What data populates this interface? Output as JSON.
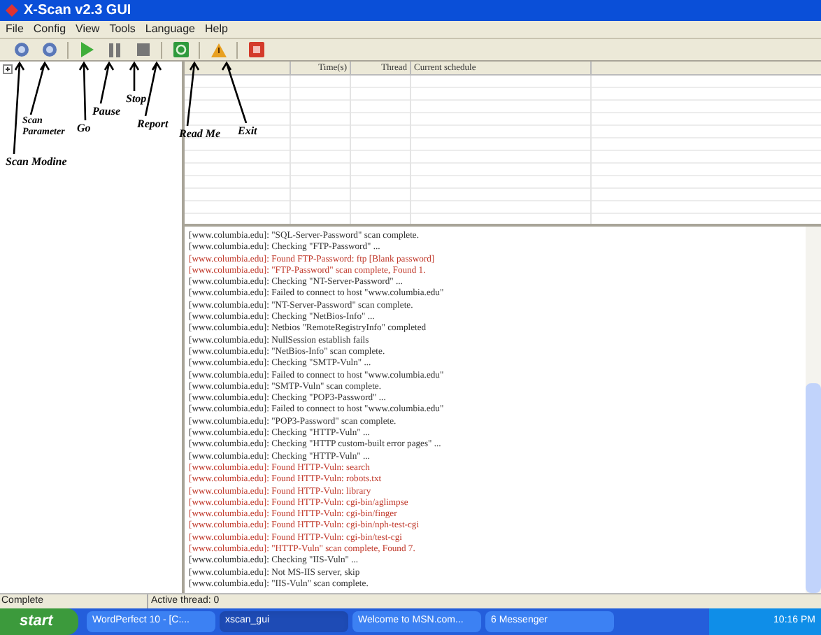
{
  "window": {
    "title": "X-Scan v2.3 GUI"
  },
  "menu": [
    "File",
    "Config",
    "View",
    "Tools",
    "Language",
    "Help"
  ],
  "toolbar": [
    {
      "kind": "module"
    },
    {
      "kind": "parameter"
    },
    {
      "kind": "go"
    },
    {
      "kind": "pause"
    },
    {
      "kind": "stop"
    },
    {
      "kind": "report"
    },
    {
      "kind": "readme"
    },
    {
      "kind": "exit"
    }
  ],
  "annotations": [
    "Scan Modine",
    "Scan Parameter",
    "Go",
    "Pause",
    "Stop",
    "Report",
    "Read Me",
    "Exit"
  ],
  "table": {
    "columns": [
      "Time(s)",
      "Thread",
      "Current schedule"
    ]
  },
  "log": [
    {
      "kind": "info",
      "text": "[www.columbia.edu]: \"SQL-Server-Password\" scan complete."
    },
    {
      "kind": "info",
      "text": "[www.columbia.edu]: Checking \"FTP-Password\" ..."
    },
    {
      "kind": "found",
      "text": "[www.columbia.edu]: Found FTP-Password: ftp [Blank password]"
    },
    {
      "kind": "found",
      "text": "[www.columbia.edu]: \"FTP-Password\" scan complete, Found 1."
    },
    {
      "kind": "info",
      "text": "[www.columbia.edu]: Checking \"NT-Server-Password\" ..."
    },
    {
      "kind": "info",
      "text": "[www.columbia.edu]: Failed to connect to host \"www.columbia.edu\""
    },
    {
      "kind": "info",
      "text": "[www.columbia.edu]: \"NT-Server-Password\" scan complete."
    },
    {
      "kind": "info",
      "text": "[www.columbia.edu]: Checking \"NetBios-Info\" ..."
    },
    {
      "kind": "info",
      "text": "[www.columbia.edu]: Netbios \"RemoteRegistryInfo\" completed"
    },
    {
      "kind": "info",
      "text": "[www.columbia.edu]: NullSession establish fails"
    },
    {
      "kind": "info",
      "text": "[www.columbia.edu]: \"NetBios-Info\" scan complete."
    },
    {
      "kind": "info",
      "text": "[www.columbia.edu]: Checking \"SMTP-Vuln\" ..."
    },
    {
      "kind": "info",
      "text": "[www.columbia.edu]: Failed to connect to host \"www.columbia.edu\""
    },
    {
      "kind": "info",
      "text": "[www.columbia.edu]: \"SMTP-Vuln\" scan complete."
    },
    {
      "kind": "info",
      "text": "[www.columbia.edu]: Checking \"POP3-Password\" ..."
    },
    {
      "kind": "info",
      "text": "[www.columbia.edu]: Failed to connect to host \"www.columbia.edu\""
    },
    {
      "kind": "info",
      "text": "[www.columbia.edu]: \"POP3-Password\" scan complete."
    },
    {
      "kind": "info",
      "text": "[www.columbia.edu]: Checking \"HTTP-Vuln\" ..."
    },
    {
      "kind": "info",
      "text": "[www.columbia.edu]: Checking \"HTTP custom-built error pages\" ..."
    },
    {
      "kind": "info",
      "text": "[www.columbia.edu]: Checking \"HTTP-Vuln\" ..."
    },
    {
      "kind": "found",
      "text": "[www.columbia.edu]: Found HTTP-Vuln: search"
    },
    {
      "kind": "found",
      "text": "[www.columbia.edu]: Found HTTP-Vuln: robots.txt"
    },
    {
      "kind": "found",
      "text": "[www.columbia.edu]: Found HTTP-Vuln: library"
    },
    {
      "kind": "found",
      "text": "[www.columbia.edu]: Found HTTP-Vuln: cgi-bin/aglimpse"
    },
    {
      "kind": "found",
      "text": "[www.columbia.edu]: Found HTTP-Vuln: cgi-bin/finger"
    },
    {
      "kind": "found",
      "text": "[www.columbia.edu]: Found HTTP-Vuln: cgi-bin/nph-test-cgi"
    },
    {
      "kind": "found",
      "text": "[www.columbia.edu]: Found HTTP-Vuln: cgi-bin/test-cgi"
    },
    {
      "kind": "found",
      "text": "[www.columbia.edu]: \"HTTP-Vuln\" scan complete, Found 7."
    },
    {
      "kind": "info",
      "text": "[www.columbia.edu]: Checking \"IIS-Vuln\" ..."
    },
    {
      "kind": "info",
      "text": "[www.columbia.edu]: Not MS-IIS server, skip"
    },
    {
      "kind": "info",
      "text": "[www.columbia.edu]: \"IIS-Vuln\" scan complete."
    }
  ],
  "status_bar": [
    "Complete",
    "Active thread: 0"
  ],
  "taskbar": {
    "start": "start",
    "tasks": [
      {
        "label": "WordPerfect 10 - [C:...",
        "selected": false
      },
      {
        "label": "xscan_gui",
        "selected": true
      },
      {
        "label": "Welcome to MSN.com...",
        "selected": false
      },
      {
        "label": "6 Messenger",
        "selected": false
      }
    ],
    "clock": "10:16 PM"
  }
}
